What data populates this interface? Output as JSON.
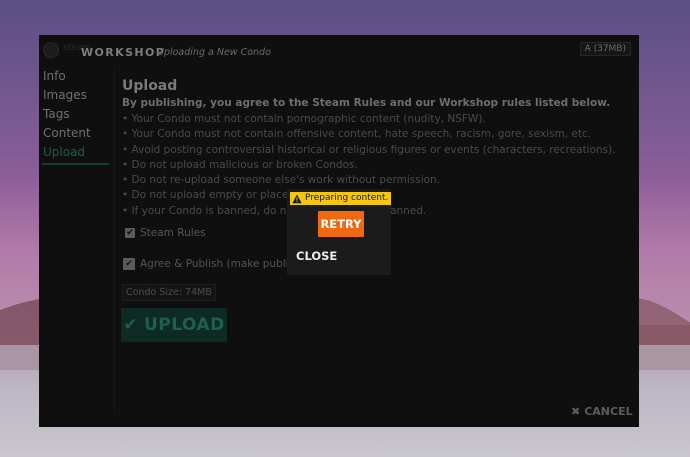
{
  "window": {
    "title_faded": "steam",
    "title": "WORKSHOP",
    "subtitle": "Uploading a New Condo",
    "size_label": "A (37MB)"
  },
  "sidebar": {
    "items": [
      {
        "label": "Info"
      },
      {
        "label": "Images"
      },
      {
        "label": "Tags"
      },
      {
        "label": "Content"
      },
      {
        "label": "Upload"
      }
    ],
    "active": "Upload"
  },
  "upload": {
    "heading": "Upload",
    "intro": "By publishing, you agree to the Steam Rules and our Workshop rules listed below.",
    "rules": [
      "• Your Condo must not contain pornographic content (nudity, NSFW).",
      "• Your Condo must not contain offensive content, hate speech, racism, gore, sexism, etc.",
      "• Avoid posting controversial historical or religious figures or events (characters, recreations).",
      "• Do not upload malicious or broken Condos.",
      "• Do not re-upload someone else's work without permission.",
      "• Do not upload empty or placeh",
      "• If your Condo is banned, do no"
    ],
    "rules_tail": "be banned.",
    "steam_rules_label": "Steam Rules",
    "agree_label": "Agree & Publish (make public)",
    "condo_size": "Condo Size: 74MB",
    "upload_button": "UPLOAD",
    "cancel_button": "CANCEL"
  },
  "dialog": {
    "status": "Preparing content.",
    "retry": "RETRY",
    "close": "CLOSE"
  },
  "colors": {
    "accent_orange": "#f0680f",
    "status_yellow": "#f4c60f",
    "upload_green": "#1d5f50"
  }
}
